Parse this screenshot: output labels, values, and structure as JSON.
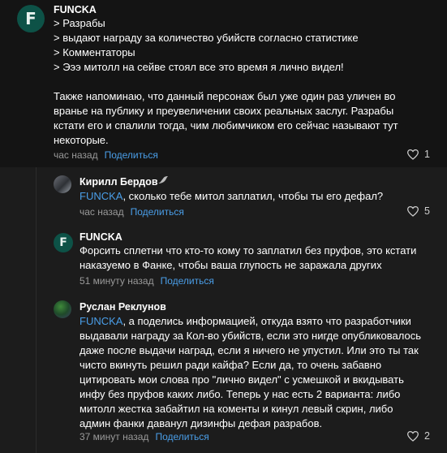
{
  "comments": [
    {
      "author": "FUNCKA",
      "avatar_letter": "F",
      "lines": [
        "> Разрабы",
        "> выдают награду за количество убийств согласно статистике",
        "> Комментаторы",
        "> Эээ митолл на сейве стоял все это время я лично видел!",
        "",
        "Также напоминаю, что данный персонаж был уже один раз уличен во",
        "вранье на публику и преувеличении своих реальных заслуг. Разрабы",
        "кстати его и спалили тогда, чим любимчиком его сейчас называют тут",
        "некоторые."
      ],
      "time": "час назад",
      "share": "Поделиться",
      "likes": "1"
    },
    {
      "author": "Кирилл Бердов",
      "lines": [
        {
          "mention": "FUNCKA",
          "rest": ", сколько тебе митол заплатил, чтобы ты его дефал?"
        }
      ],
      "time": "час назад",
      "share": "Поделиться",
      "likes": "5"
    },
    {
      "author": "FUNCKA",
      "avatar_letter": "F",
      "lines": [
        "Форсить сплетни что кто-то кому то заплатил без пруфов, это кстати",
        "наказуемо в Фанке, чтобы ваша глупость не заражала других"
      ],
      "time": "51 минуту назад",
      "share": "Поделиться"
    },
    {
      "author": "Руслан Реклунов",
      "lines": [
        {
          "mention": "FUNCKA",
          "rest": ", а поделись информацией, откуда взято что разработчики"
        },
        "выдавали награду за Кол-во убийств, если это нигде опубликовалось",
        "даже после выдачи наград, если я ничего не упустил. Или это ты так",
        "чисто вкинуть решил ради кайфа? Если да, то очень забавно",
        "цитировать мои слова про \"лично видел\" с усмешкой и вкидывать",
        "инфу без пруфов каких либо. Теперь у нас есть 2 варианта: либо",
        "митолл жестка забайтил на коменты и кинул левый скрин, либо",
        "админ фанки даванул дизинфы дефая разрабов."
      ],
      "time": "37 минут назад",
      "share": "Поделиться",
      "likes": "2"
    }
  ]
}
